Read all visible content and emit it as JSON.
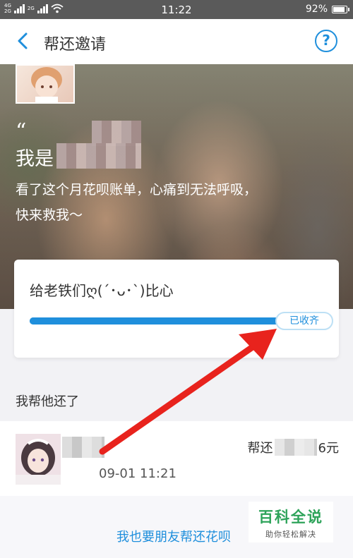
{
  "status_bar": {
    "network_top": "4G",
    "network_bottom": "2G",
    "network_top2": "2G",
    "time": "11:22",
    "battery_percent": "92%",
    "battery_level": 0.92
  },
  "navbar": {
    "title": "帮还邀请",
    "help_symbol": "?"
  },
  "hero": {
    "quote_mark": "“",
    "name_prefix": "我是",
    "message": "看了这个月花呗账单，心痛到无法呼吸，快来救我～"
  },
  "card": {
    "title": "给老铁们ღ(´･ᴗ･`)比心",
    "status_pill": "已收齐",
    "progress": 1.0
  },
  "section": {
    "title": "我帮他还了"
  },
  "helper_row": {
    "time": "09-01 11:21",
    "help_prefix": "帮还",
    "help_suffix": "6元"
  },
  "bottom": {
    "link": "我也要朋友帮还花呗"
  },
  "watermark": {
    "title": "百科全说",
    "subtitle": "助你轻松解决"
  },
  "colors": {
    "accent": "#1f8fdc",
    "arrow": "#e8231d",
    "watermark_green": "#2ea35a"
  }
}
